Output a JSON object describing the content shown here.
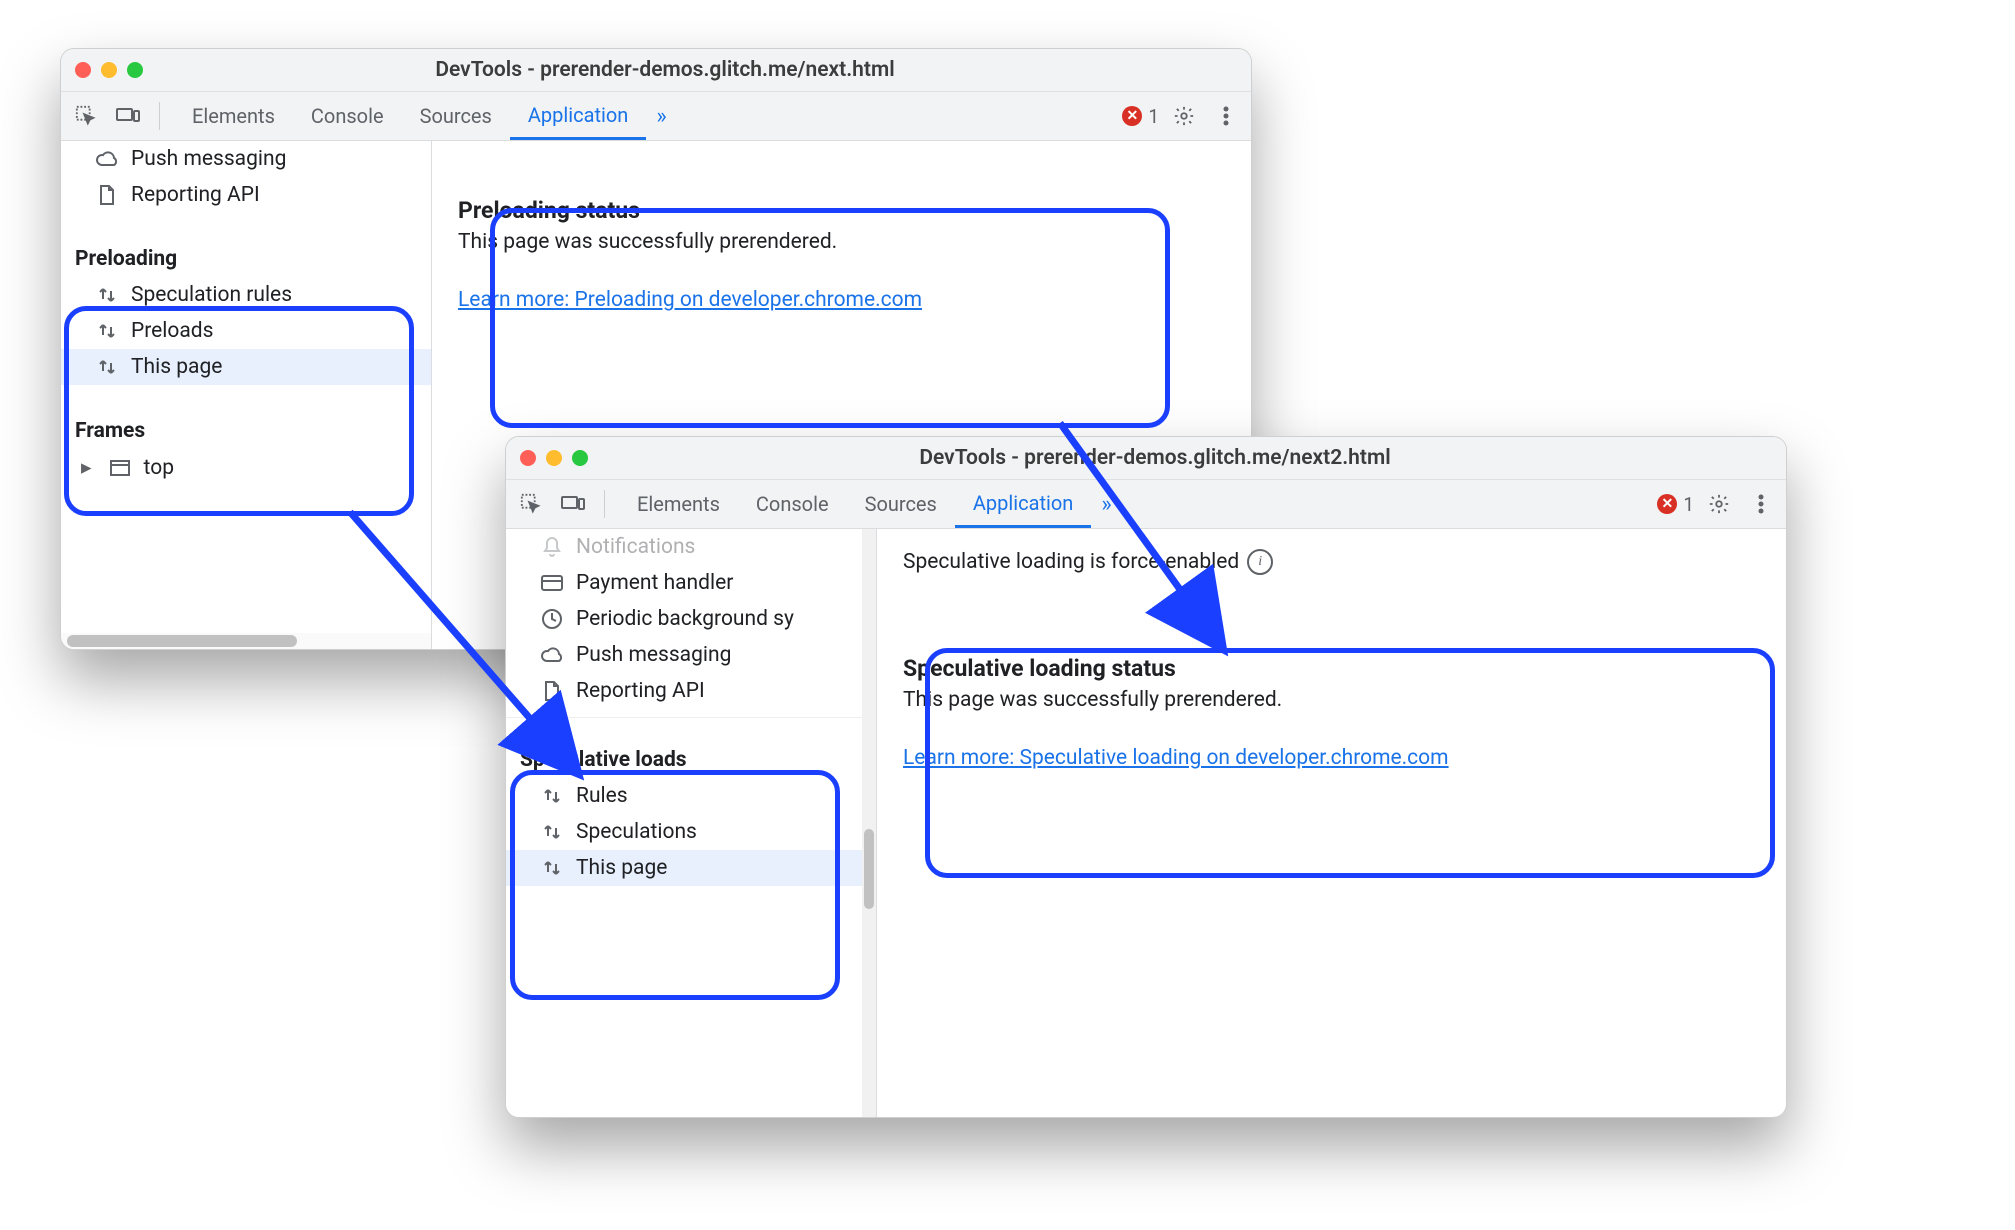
{
  "window1": {
    "title": "DevTools - prerender-demos.glitch.me/next.html",
    "tabs": [
      "Elements",
      "Console",
      "Sources",
      "Application"
    ],
    "activeTab": 3,
    "moreGlyph": "»",
    "errorCount": "1",
    "sidebar": {
      "topItems": [
        {
          "icon": "cloud",
          "label": "Push messaging"
        },
        {
          "icon": "file",
          "label": "Reporting API"
        }
      ],
      "preloadingTitle": "Preloading",
      "preloadingItems": [
        {
          "label": "Speculation rules"
        },
        {
          "label": "Preloads"
        },
        {
          "label": "This page",
          "selected": true
        }
      ],
      "framesTitle": "Frames",
      "frameItem": "top"
    },
    "panel": {
      "title": "Preloading status",
      "message": "This page was successfully prerendered.",
      "link": "Learn more: Preloading on developer.chrome.com"
    }
  },
  "window2": {
    "title": "DevTools - prerender-demos.glitch.me/next2.html",
    "tabs": [
      "Elements",
      "Console",
      "Sources",
      "Application"
    ],
    "activeTab": 3,
    "moreGlyph": "»",
    "errorCount": "1",
    "notice": "Speculative loading is force-enabled",
    "sidebar": {
      "topItems": [
        {
          "icon": "bell",
          "label": "Notifications"
        },
        {
          "icon": "card",
          "label": "Payment handler"
        },
        {
          "icon": "clock",
          "label": "Periodic background sy"
        },
        {
          "icon": "cloud",
          "label": "Push messaging"
        },
        {
          "icon": "file",
          "label": "Reporting API"
        }
      ],
      "specTitle": "Speculative loads",
      "specItems": [
        {
          "label": "Rules"
        },
        {
          "label": "Speculations"
        },
        {
          "label": "This page",
          "selected": true
        }
      ]
    },
    "panel": {
      "title": "Speculative loading status",
      "message": "This page was successfully prerendered.",
      "link": "Learn more: Speculative loading on developer.chrome.com"
    }
  }
}
